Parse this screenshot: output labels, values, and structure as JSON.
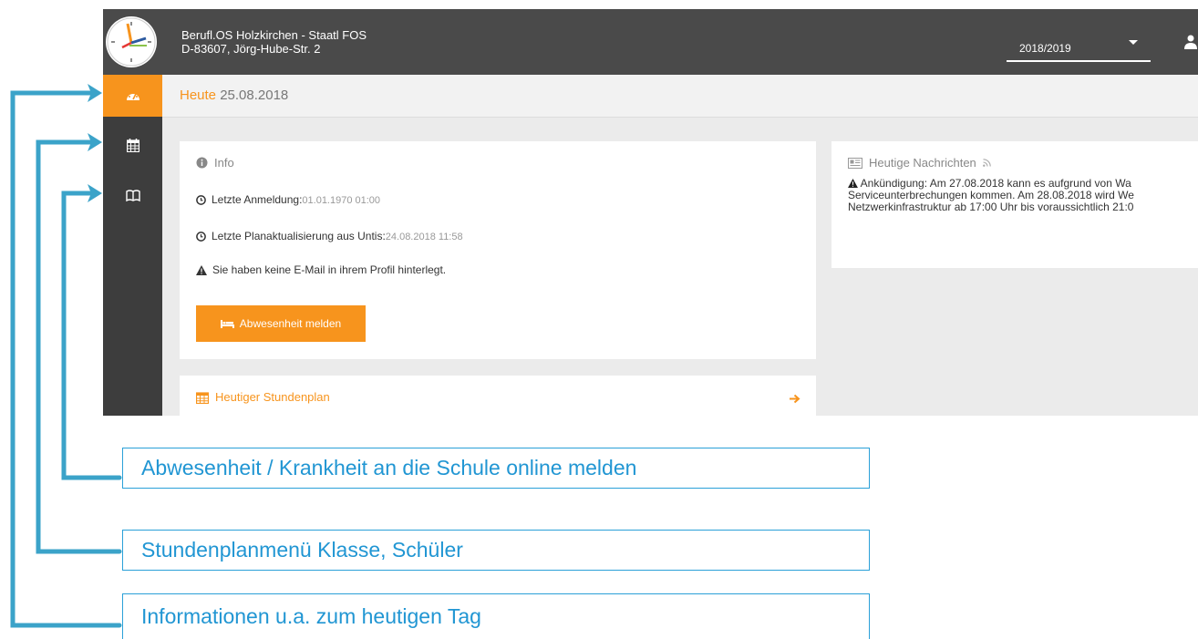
{
  "header": {
    "school_name": "Berufl.OS Holzkirchen - Staatl FOS",
    "school_address": "D-83607, Jörg-Hube-Str. 2",
    "school_year": "2018/2019"
  },
  "sidebar": {
    "items": [
      {
        "icon": "dashboard-icon",
        "active": true
      },
      {
        "icon": "calendar-icon",
        "active": false
      },
      {
        "icon": "book-icon",
        "active": false
      }
    ]
  },
  "page": {
    "title": "Heute",
    "date": "25.08.2018"
  },
  "info_card": {
    "title": "Info",
    "last_login_label": "Letzte Anmeldung:",
    "last_login_value": "01.01.1970 01:00",
    "last_update_label": "Letzte Planaktualisierung aus Untis:",
    "last_update_value": "24.08.2018 11:58",
    "warning": "Sie haben keine E-Mail in ihrem Profil hinterlegt.",
    "absence_button": "Abwesenheit melden"
  },
  "timetable_card": {
    "title": "Heutiger Stundenplan"
  },
  "news_card": {
    "title": "Heutige Nachrichten",
    "lines": [
      "Ankündigung: Am 27.08.2018 kann es aufgrund von Wa",
      "Serviceunterbrechungen kommen. Am 28.08.2018 wird We",
      "Netzwerkinfrastruktur ab 17:00 Uhr bis voraussichtlich 21:0"
    ]
  },
  "annotations": [
    "Abwesenheit / Krankheit an die Schule online melden",
    "Stundenplanmenü Klasse, Schüler",
    "Informationen u.a. zum heutigen Tag"
  ],
  "colors": {
    "accent": "#f7941d",
    "topbar": "#4a4a4a",
    "sidebar": "#3d3d3d",
    "annotation": "#2aa0d8"
  }
}
